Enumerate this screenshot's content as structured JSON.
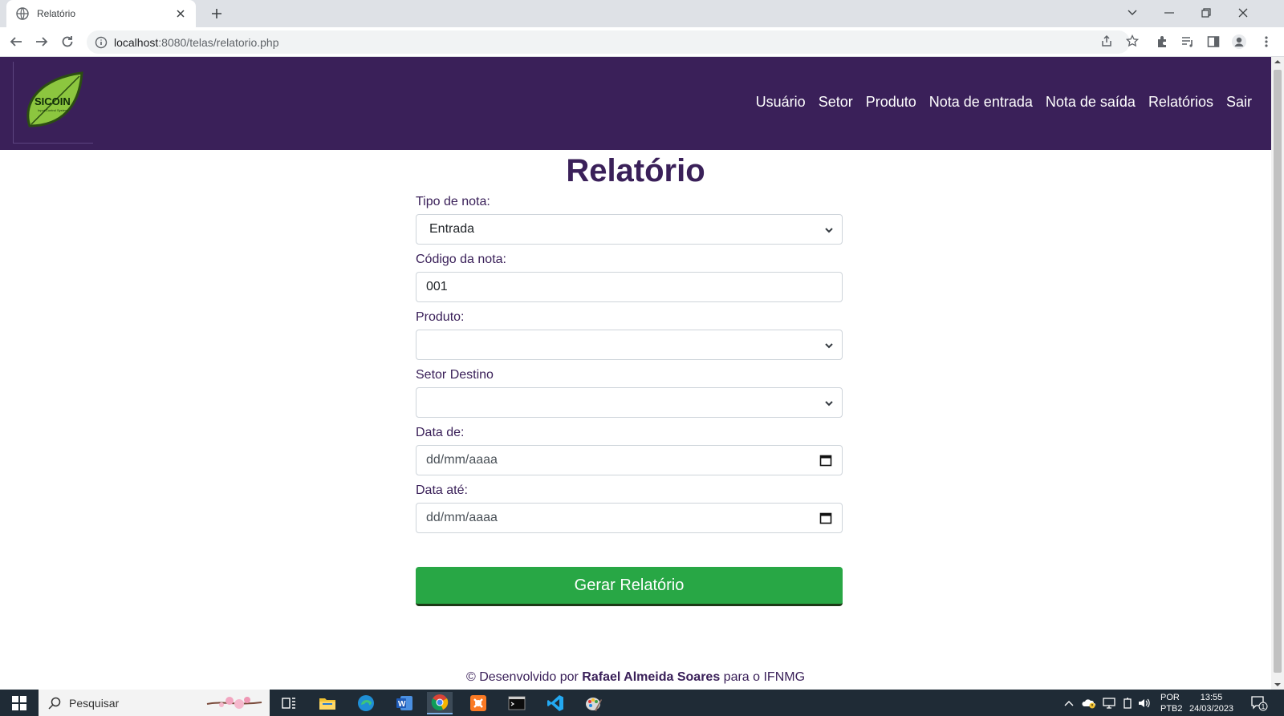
{
  "browser": {
    "tab_title": "Relatório",
    "url_host": "localhost",
    "url_path": ":8080/telas/relatorio.php"
  },
  "navbar": {
    "logo_text": "SICOIN",
    "logo_subtext": "Input Control System",
    "menu": [
      "Usuário",
      "Setor",
      "Produto",
      "Nota de entrada",
      "Nota de saída",
      "Relatórios",
      "Sair"
    ]
  },
  "page": {
    "title": "Relatório"
  },
  "form": {
    "tipo_label": "Tipo de nota:",
    "tipo_value": "Entrada",
    "codigo_label": "Código da nota:",
    "codigo_value": "001",
    "produto_label": "Produto:",
    "produto_value": "",
    "setor_label": "Setor Destino",
    "setor_value": "",
    "data_de_label": "Data de:",
    "data_de_placeholder": "dd/mm/aaaa",
    "data_ate_label": "Data até:",
    "data_ate_placeholder": "dd/mm/aaaa",
    "submit_label": "Gerar Relatório"
  },
  "footer": {
    "prefix": "© Desenvolvido por ",
    "author": "Rafael Almeida Soares",
    "suffix": " para o IFNMG"
  },
  "taskbar": {
    "search_placeholder": "Pesquisar",
    "lang_top": "POR",
    "lang_bottom": "PTB2",
    "time": "13:55",
    "date": "24/03/2023",
    "notification_count": "1"
  },
  "colors": {
    "nav_bg": "#3a2059",
    "submit_bg": "#28a745",
    "title_color": "#3a2059"
  }
}
